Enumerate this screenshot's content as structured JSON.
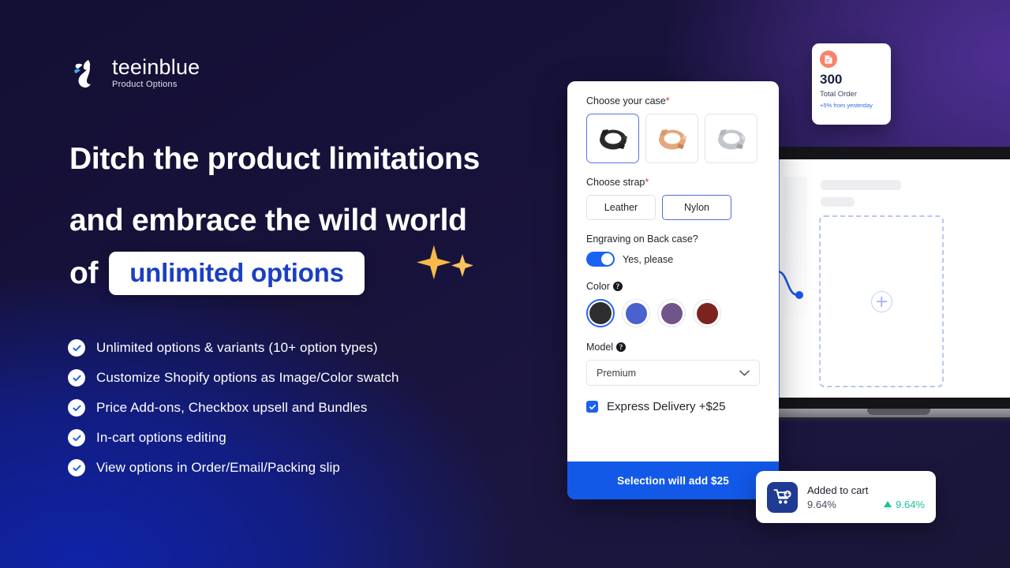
{
  "brand": {
    "name": "teeinblue",
    "tagline": "Product Options",
    "logo_icon": "water-droplet-icon",
    "accent_blue": "#1b3fc4",
    "accent_light_blue": "#3da9f5"
  },
  "headline": {
    "line1": "Ditch the product limitations",
    "line2": "and embrace the wild world",
    "line3_prefix": "of",
    "line3_highlight": "unlimited options"
  },
  "features": [
    {
      "label": "Unlimited options & variants (10+ option types)",
      "icon": "check-circle-icon"
    },
    {
      "label": "Customize Shopify options as Image/Color swatch",
      "icon": "check-circle-icon"
    },
    {
      "label": "Price Add-ons, Checkbox upsell and Bundles",
      "icon": "check-circle-icon"
    },
    {
      "label": "In-cart options editing",
      "icon": "check-circle-icon"
    },
    {
      "label": "View options in Order/Email/Packing slip",
      "icon": "check-circle-icon"
    }
  ],
  "options_panel": {
    "case": {
      "label": "Choose your case",
      "required_mark": "*",
      "swatches": [
        {
          "name": "Black case",
          "color": "#2a2a2c",
          "selected": true
        },
        {
          "name": "Rose gold case",
          "color": "#e3a87e",
          "selected": false
        },
        {
          "name": "Silver case",
          "color": "#c3c6cb",
          "selected": false
        }
      ]
    },
    "strap": {
      "label": "Choose strap",
      "required_mark": "*",
      "options": [
        {
          "label": "Leather",
          "selected": false
        },
        {
          "label": "Nylon",
          "selected": true
        }
      ]
    },
    "engraving": {
      "label": "Engraving on Back case?",
      "toggle_label": "Yes, please",
      "toggle_on": true
    },
    "color": {
      "label": "Color",
      "help_icon": "question-mark-icon",
      "swatches": [
        {
          "name": "Charcoal",
          "hex": "#2e2e30",
          "selected": true
        },
        {
          "name": "Blue",
          "hex": "#4a61cf",
          "selected": false
        },
        {
          "name": "Purple",
          "hex": "#70548a",
          "selected": false
        },
        {
          "name": "Dark red",
          "hex": "#7c2320",
          "selected": false
        }
      ]
    },
    "model": {
      "label": "Model",
      "help_icon": "question-mark-icon",
      "selected_value": "Premium",
      "chevron_icon": "chevron-down-icon"
    },
    "express_delivery": {
      "label": "Express Delivery +$25",
      "checked": true
    },
    "cta_label": "Selection will add $25",
    "cta_color": "#1259e8"
  },
  "stat_card": {
    "icon": "order-document-icon",
    "icon_color": "#f8836a",
    "value": "300",
    "caption": "Total Order",
    "delta": "+5% from yesterday",
    "delta_color": "#2f6bdd"
  },
  "cart_card": {
    "icon": "shopping-cart-download-icon",
    "title": "Added to cart",
    "percent": "9.64%",
    "delta": "9.64%",
    "delta_icon": "triangle-up-icon",
    "delta_color": "#1ec49a"
  },
  "laptop_mockup": {
    "placeholder_icon": "plus-circle-icon",
    "dropzone_name": "image-dropzone"
  }
}
